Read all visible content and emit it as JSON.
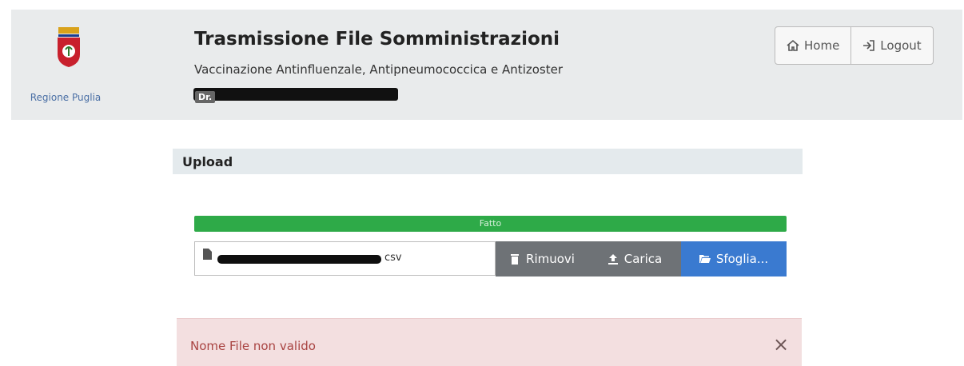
{
  "header": {
    "region_name": "Regione Puglia",
    "title": "Trasmissione File Somministrazioni",
    "subtitle": "Vaccinazione Antinfluenzale, Antipneumococcica e Antizoster",
    "doctor_prefix": "Dr.",
    "nav": {
      "home_label": "Home",
      "logout_label": "Logout"
    }
  },
  "upload": {
    "panel_title": "Upload",
    "progress": {
      "label": "Fatto",
      "percent": 100
    },
    "file": {
      "extension_visible": "csv"
    },
    "buttons": {
      "remove": "Rimuovi",
      "upload": "Carica",
      "browse": "Sfoglia..."
    }
  },
  "alert": {
    "message": "Nome File non valido",
    "close_symbol": "×"
  },
  "colors": {
    "progress_green": "#2eaa48",
    "button_gray": "#6e7276",
    "button_blue": "#3a7ad0",
    "alert_bg": "#f3dfe0",
    "alert_text": "#a94442"
  }
}
